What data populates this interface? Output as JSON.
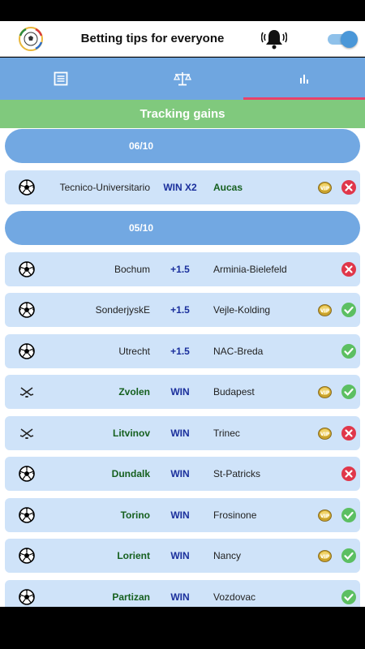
{
  "app": {
    "title": "Betting tips for everyone",
    "logo_icon": "soccer-logo-icon",
    "bell_icon": "bell-icon",
    "toggle_on": true
  },
  "tabs": [
    {
      "icon": "document-icon",
      "selected": false
    },
    {
      "icon": "scales-icon",
      "selected": false
    },
    {
      "icon": "bar-chart-icon",
      "selected": true
    }
  ],
  "banner": {
    "title": "Tracking gains"
  },
  "colors": {
    "tab_bar": "#6fa6e0",
    "banner": "#80c97d",
    "date_row": "#72a8e2",
    "match_row": "#cfe3f9",
    "tip_text": "#1a2f9c",
    "favorite_text": "#16601f",
    "win": "#5cbf62",
    "loss": "#e0374a",
    "indicator": "#e8416b"
  },
  "sections": [
    {
      "date": "06/10",
      "matches": [
        {
          "sport": "soccer",
          "home": "Tecnico-Universitario",
          "home_fav": false,
          "tip": "WIN X2",
          "away": "Aucas",
          "away_fav": true,
          "vip": true,
          "result": "loss"
        }
      ]
    },
    {
      "date": "05/10",
      "matches": [
        {
          "sport": "soccer",
          "home": "Bochum",
          "home_fav": false,
          "tip": "+1.5",
          "away": "Arminia-Bielefeld",
          "away_fav": false,
          "vip": false,
          "result": "loss"
        },
        {
          "sport": "soccer",
          "home": "SonderjyskE",
          "home_fav": false,
          "tip": "+1.5",
          "away": "Vejle-Kolding",
          "away_fav": false,
          "vip": true,
          "result": "win"
        },
        {
          "sport": "soccer",
          "home": "Utrecht",
          "home_fav": false,
          "tip": "+1.5",
          "away": "NAC-Breda",
          "away_fav": false,
          "vip": false,
          "result": "win"
        },
        {
          "sport": "hockey",
          "home": "Zvolen",
          "home_fav": true,
          "tip": "WIN",
          "away": "Budapest",
          "away_fav": false,
          "vip": true,
          "result": "win"
        },
        {
          "sport": "hockey",
          "home": "Litvinov",
          "home_fav": true,
          "tip": "WIN",
          "away": "Trinec",
          "away_fav": false,
          "vip": true,
          "result": "loss"
        },
        {
          "sport": "soccer",
          "home": "Dundalk",
          "home_fav": true,
          "tip": "WIN",
          "away": "St-Patricks",
          "away_fav": false,
          "vip": false,
          "result": "loss"
        },
        {
          "sport": "soccer",
          "home": "Torino",
          "home_fav": true,
          "tip": "WIN",
          "away": "Frosinone",
          "away_fav": false,
          "vip": true,
          "result": "win"
        },
        {
          "sport": "soccer",
          "home": "Lorient",
          "home_fav": true,
          "tip": "WIN",
          "away": "Nancy",
          "away_fav": false,
          "vip": true,
          "result": "win"
        },
        {
          "sport": "soccer",
          "home": "Partizan",
          "home_fav": true,
          "tip": "WIN",
          "away": "Vozdovac",
          "away_fav": false,
          "vip": false,
          "result": "win"
        }
      ]
    }
  ]
}
